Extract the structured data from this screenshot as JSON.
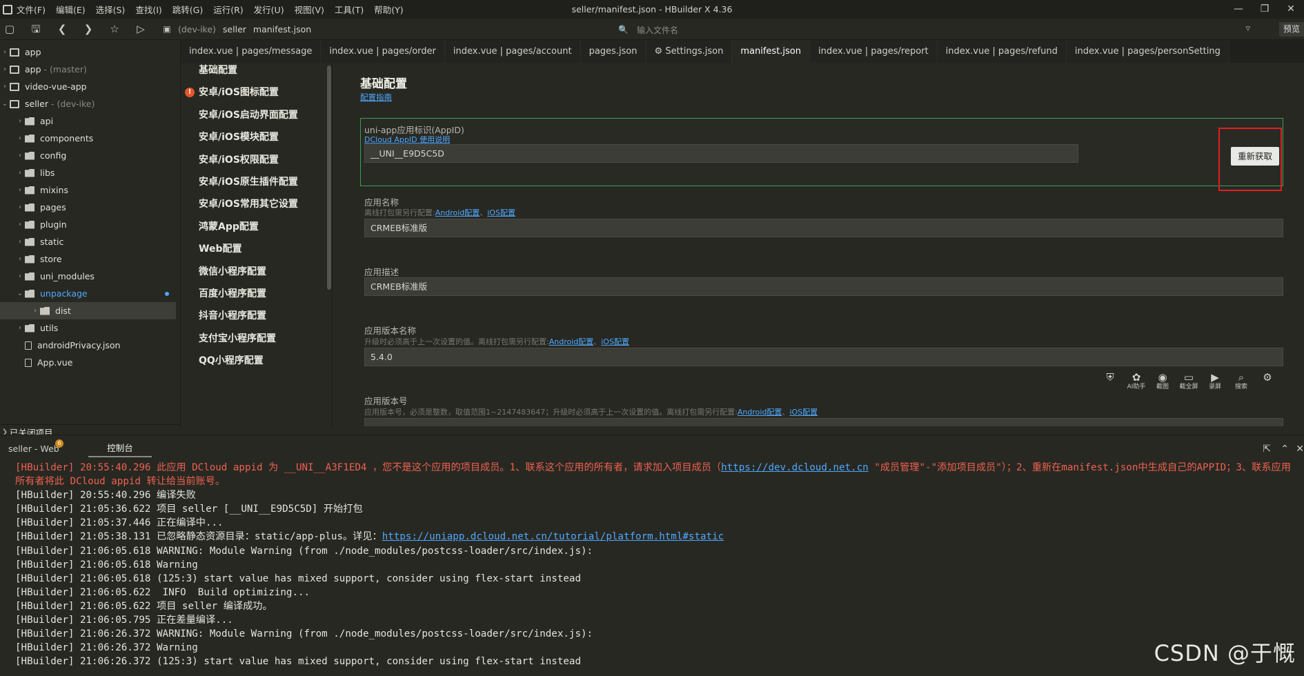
{
  "window": {
    "title": "seller/manifest.json - HBuilder X 4.36",
    "menu": [
      "文件(F)",
      "编辑(E)",
      "选择(S)",
      "查找(I)",
      "跳转(G)",
      "运行(R)",
      "发行(U)",
      "视图(V)",
      "工具(T)",
      "帮助(Y)"
    ]
  },
  "toolbar": {
    "breadcrumb": [
      "(dev-ike)",
      "seller",
      "manifest.json"
    ],
    "search_placeholder": "输入文件名",
    "preview_label": "预览"
  },
  "sidebar": {
    "projects": [
      {
        "label": "app",
        "extra": ""
      },
      {
        "label": "app",
        "extra": "- (master)"
      },
      {
        "label": "video-vue-app",
        "extra": ""
      },
      {
        "label": "seller",
        "extra": "- (dev-ike)"
      }
    ],
    "folders": [
      "api",
      "components",
      "config",
      "libs",
      "mixins",
      "pages",
      "plugin",
      "static",
      "store",
      "uni_modules",
      "unpackage",
      "dist",
      "utils"
    ],
    "files": [
      "androidPrivacy.json",
      "App.vue"
    ],
    "closed_projects": "已关闭项目"
  },
  "tabs": [
    "index.vue | pages/message",
    "index.vue | pages/order",
    "index.vue | pages/account",
    "pages.json",
    "Settings.json",
    "manifest.json",
    "index.vue | pages/report",
    "index.vue | pages/refund",
    "index.vue | pages/personSetting"
  ],
  "config_nav": [
    "基础配置",
    "安卓/iOS图标配置",
    "安卓/iOS启动界面配置",
    "安卓/iOS模块配置",
    "安卓/iOS权限配置",
    "安卓/iOS原生插件配置",
    "安卓/iOS常用其它设置",
    "鸿蒙App配置",
    "Web配置",
    "微信小程序配置",
    "百度小程序配置",
    "抖音小程序配置",
    "支付宝小程序配置",
    "QQ小程序配置"
  ],
  "form": {
    "title": "基础配置",
    "guide_link": "配置指南",
    "appid_label": "uni-app应用标识(AppID)",
    "appid_help": "DCloud AppID 使用说明",
    "appid_value": "__UNI__E9D5C5D",
    "regen_label": "重新获取",
    "name_label": "应用名称",
    "name_hint": "离线打包需另行配置:",
    "name_value": "CRMEB标准版",
    "desc_label": "应用描述",
    "desc_value": "CRMEB标准版",
    "vname_label": "应用版本名称",
    "vname_hint": "升级时必须高于上一次设置的值。离线打包需另行配置:",
    "vname_value": "5.4.0",
    "vcode_label": "应用版本号",
    "vcode_hint": "应用版本号，必须是整数，取值范围1~2147483647；升级时必须高于上一次设置的值。离线打包需另行配置:",
    "link_android": "Android配置",
    "link_ios": "iOS配置",
    "link_sep": "、"
  },
  "mini_tools": [
    "AI助手",
    "截图",
    "截全屏",
    "录屏",
    "搜索"
  ],
  "console": {
    "tab1": "seller - Web",
    "tab2": "控制台",
    "badge": "6",
    "lines": [
      {
        "prefix": "[HBuilder] 20:55:40.296 ",
        "text": "此应用 DCloud appid 为 __UNI__A3F1ED4 ，您不是这个应用的项目成员。1、联系这个应用的所有者，请求加入项目成员（",
        "link": "https://dev.dcloud.net.cn",
        "after": " \"成员管理\"-\"添加项目成员\"）；2、重新在manifest.json中生成自己的APPID；3、联系应用所有者将此 DCloud appid 转让给当前账号。",
        "red": true
      },
      {
        "prefix": "[HBuilder] 20:55:40.296 ",
        "text": "编译失败"
      },
      {
        "prefix": "[HBuilder] 21:05:36.622 ",
        "text": "项目 seller [__UNI__E9D5C5D] 开始打包"
      },
      {
        "prefix": "[HBuilder] 21:05:37.446 ",
        "text": "正在编译中..."
      },
      {
        "prefix": "[HBuilder] 21:05:38.131 ",
        "text": "已忽略静态资源目录：static/app-plus。详见：",
        "link": "https://uniapp.dcloud.net.cn/tutorial/platform.html#static"
      },
      {
        "prefix": "[HBuilder] 21:06:05.618 ",
        "text": "WARNING: Module Warning (from ./node_modules/postcss-loader/src/index.js):"
      },
      {
        "prefix": "[HBuilder] 21:06:05.618 ",
        "text": "Warning"
      },
      {
        "prefix": "[HBuilder] 21:06:05.618 ",
        "text": "(125:3) start value has mixed support, consider using flex-start instead"
      },
      {
        "prefix": "[HBuilder] 21:06:05.622 ",
        "text": " INFO  Build optimizing..."
      },
      {
        "prefix": "[HBuilder] 21:06:05.622 ",
        "text": "项目 seller 编译成功。"
      },
      {
        "prefix": "[HBuilder] 21:06:05.795 ",
        "text": "正在差量编译..."
      },
      {
        "prefix": "[HBuilder] 21:06:26.372 ",
        "text": "WARNING: Module Warning (from ./node_modules/postcss-loader/src/index.js):"
      },
      {
        "prefix": "[HBuilder] 21:06:26.372 ",
        "text": "Warning"
      },
      {
        "prefix": "[HBuilder] 21:06:26.372 ",
        "text": "(125:3) start value has mixed support, consider using flex-start instead"
      }
    ]
  },
  "watermark": "CSDN @于慨"
}
